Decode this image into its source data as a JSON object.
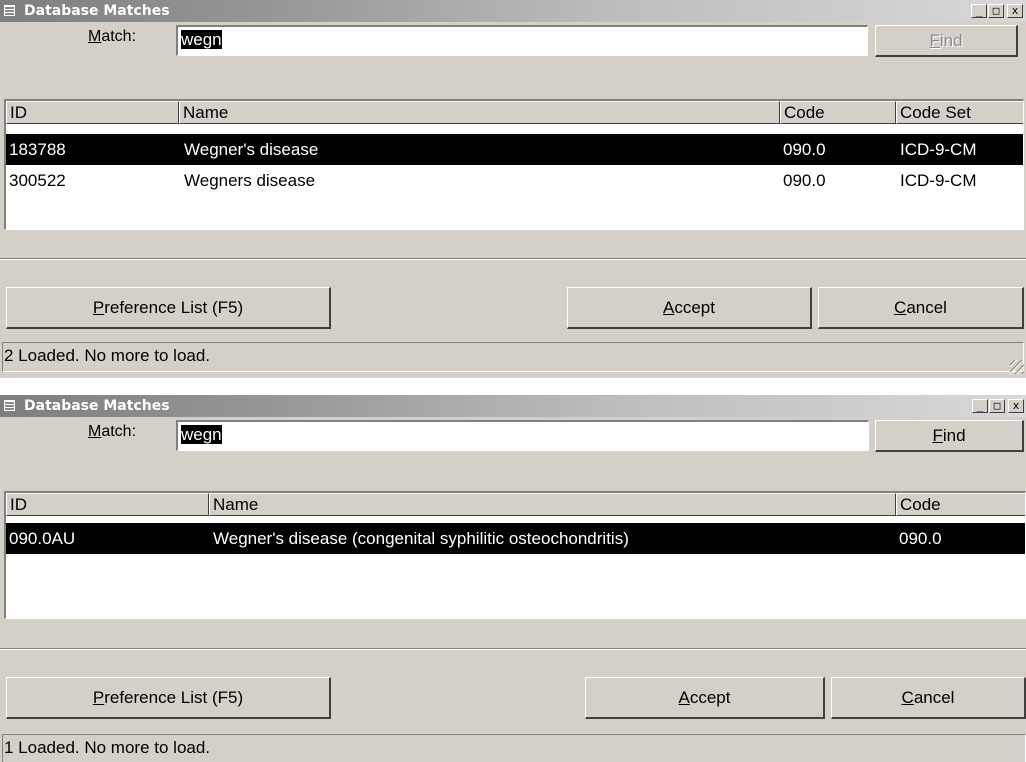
{
  "windows": [
    {
      "title": "Database Matches",
      "controls": {
        "minimize": "_",
        "maximize": "□",
        "close": "x"
      },
      "match": {
        "label": "Match:",
        "value": "wegn"
      },
      "find_label": "Find",
      "find_enabled": false,
      "columns": [
        "ID",
        "Name",
        "Code",
        "Code Set"
      ],
      "rows": [
        {
          "id": "183788",
          "name": "Wegner's disease",
          "code": "090.0",
          "code_set": "ICD-9-CM",
          "selected": true
        },
        {
          "id": "300522",
          "name": "Wegners disease",
          "code": "090.0",
          "code_set": "ICD-9-CM",
          "selected": false
        }
      ],
      "buttons": {
        "preference": "Preference List (F5)",
        "accept": "Accept",
        "cancel": "Cancel"
      },
      "status": "2 Loaded. No more to load."
    },
    {
      "title": "Database Matches",
      "controls": {
        "minimize": "_",
        "maximize": "□",
        "close": "x"
      },
      "match": {
        "label": "Match:",
        "value": "wegn"
      },
      "find_label": "Find",
      "find_enabled": true,
      "columns": [
        "ID",
        "Name",
        "Code"
      ],
      "rows": [
        {
          "id": "090.0AU",
          "name": "Wegner's disease (congenital syphilitic osteochondritis)",
          "code": "090.0",
          "selected": true
        }
      ],
      "buttons": {
        "preference": "Preference List (F5)",
        "accept": "Accept",
        "cancel": "Cancel"
      },
      "status": "1 Loaded. No more to load."
    }
  ]
}
